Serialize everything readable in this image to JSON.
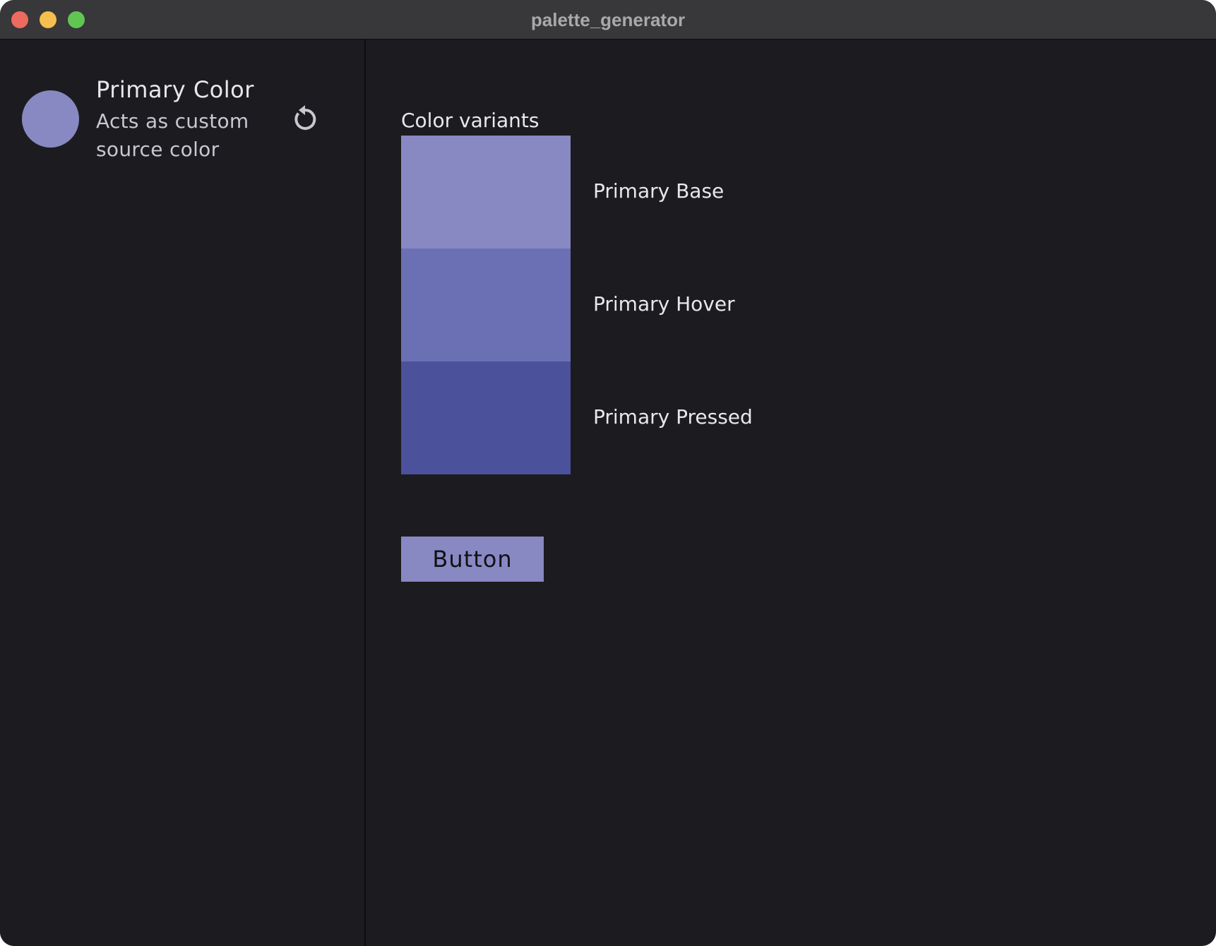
{
  "window": {
    "title": "palette_generator"
  },
  "colors": {
    "close": "#ed6a5e",
    "minimize": "#f5bf4f",
    "zoom": "#61c554",
    "primary_base": "#8889c2",
    "primary_hover": "#6b70b4",
    "primary_pressed": "#4b519b",
    "icon": "#c9c7cf"
  },
  "sidebar": {
    "primary": {
      "title": "Primary Color",
      "subtitle": "Acts as custom source color",
      "reset_icon": "reset-icon"
    }
  },
  "main": {
    "section_label": "Color variants",
    "variants": [
      {
        "label": "Primary Base"
      },
      {
        "label": "Primary Hover"
      },
      {
        "label": "Primary Pressed"
      }
    ],
    "button_label": "Button"
  }
}
